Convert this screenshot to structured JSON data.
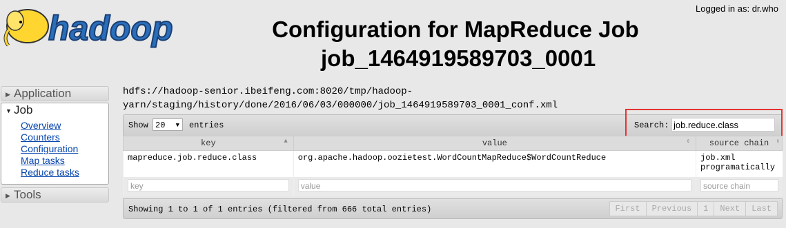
{
  "header": {
    "logo_text": "hadoop",
    "logged_in": "Logged in as: dr.who",
    "title_line1": "Configuration for MapReduce Job",
    "title_line2": "job_1464919589703_0001"
  },
  "nav": {
    "application": "Application",
    "job": "Job",
    "job_links": [
      "Overview",
      "Counters",
      "Configuration",
      "Map tasks",
      "Reduce tasks"
    ],
    "tools": "Tools"
  },
  "path": "hdfs://hadoop-senior.ibeifeng.com:8020/tmp/hadoop-yarn/staging/history/done/2016/06/03/000000/job_1464919589703_0001_conf.xml",
  "toolbar": {
    "show": "Show",
    "page_size": "20",
    "entries": "entries",
    "search_label": "Search:",
    "search_value": "job.reduce.class"
  },
  "table": {
    "columns": [
      "key",
      "value",
      "source chain"
    ],
    "rows": [
      {
        "key": "mapreduce.job.reduce.class",
        "value": "org.apache.hadoop.oozietest.WordCountMapReduce$WordCountReduce",
        "source_line1": "job.xml",
        "source_line2": "programatically"
      }
    ],
    "filters": {
      "key": "key",
      "value": "value",
      "source": "source chain"
    }
  },
  "footer": {
    "info": "Showing 1 to 1 of 1 entries (filtered from 666 total entries)",
    "pager": [
      "First",
      "Previous",
      "1",
      "Next",
      "Last"
    ]
  }
}
